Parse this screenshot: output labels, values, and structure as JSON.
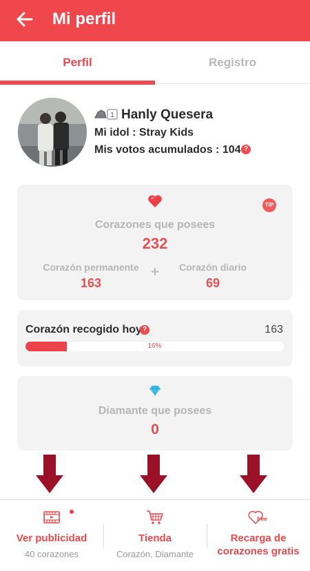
{
  "header": {
    "title": "Mi perfil"
  },
  "tabs": [
    {
      "label": "Perfil",
      "active": true
    },
    {
      "label": "Registro",
      "active": false
    }
  ],
  "profile": {
    "level": "1",
    "name": "Hanly Quesera",
    "idol_line": "Mi idol : Stray Kids",
    "votes_line": "Mis votos acumulados :  104"
  },
  "hearts_card": {
    "tip": "TIP",
    "label": "Corazones que posees",
    "total": "232",
    "permanent_label": "Corazón permanente",
    "permanent_value": "163",
    "plus": "+",
    "daily_label": "Corazón diario",
    "daily_value": "69"
  },
  "today_card": {
    "label": "Corazón recogido hoy",
    "value": "163",
    "progress_percent": 16,
    "progress_text": "16%"
  },
  "diamond_card": {
    "label": "Diamante que posees",
    "value": "0"
  },
  "bottom_bar": [
    {
      "title": "Ver publicidad",
      "subtitle": "40 corazones",
      "icon": "video-icon"
    },
    {
      "title": "Tienda",
      "subtitle": "Corazón, Diamante",
      "icon": "cart-icon"
    },
    {
      "title": "Recarga de corazones gratis",
      "subtitle": "",
      "icon": "free-heart-icon"
    }
  ],
  "colors": {
    "brand_red": "#f0474c",
    "value_red": "#e84f52",
    "arrow_maroon": "#9b1228"
  },
  "help_glyph": "?"
}
